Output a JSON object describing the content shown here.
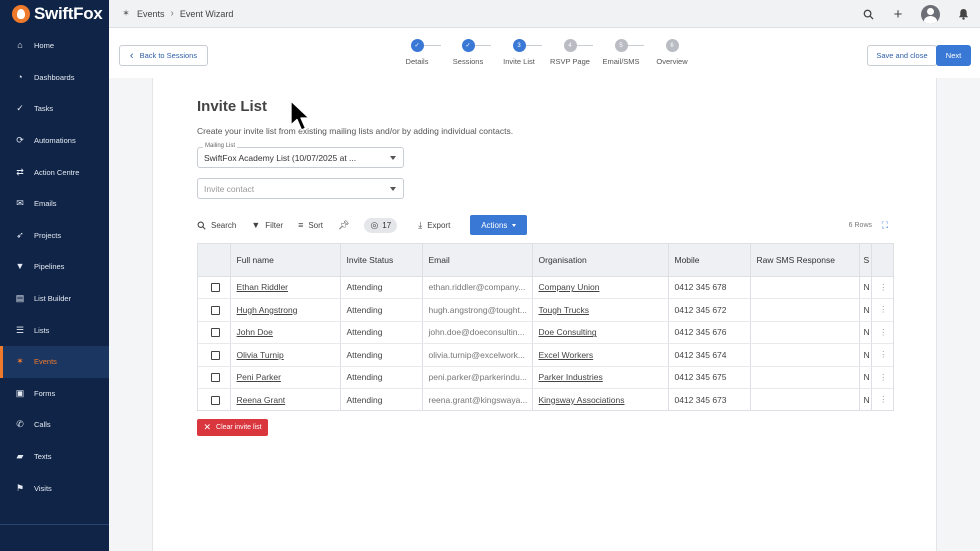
{
  "app": {
    "name": "SwiftFox",
    "brand_color": "#f07a2c",
    "sidebar_bg": "#0f2447",
    "accent": "#3a78d6",
    "danger": "#d9363e"
  },
  "sidebar": {
    "items": [
      {
        "label": "Home",
        "icon": "home-icon"
      },
      {
        "label": "Dashboards",
        "icon": "dashboard-icon"
      },
      {
        "label": "Tasks",
        "icon": "check-circle-icon"
      },
      {
        "label": "Automations",
        "icon": "sync-icon"
      },
      {
        "label": "Action Centre",
        "icon": "shuffle-icon"
      },
      {
        "label": "Emails",
        "icon": "mail-icon"
      },
      {
        "label": "Projects",
        "icon": "rocket-icon"
      },
      {
        "label": "Pipelines",
        "icon": "filter-icon"
      },
      {
        "label": "List Builder",
        "icon": "list-builder-icon"
      },
      {
        "label": "Lists",
        "icon": "list-icon"
      },
      {
        "label": "Events",
        "icon": "party-popper-icon"
      },
      {
        "label": "Forms",
        "icon": "clipboard-icon"
      },
      {
        "label": "Calls",
        "icon": "phone-icon"
      },
      {
        "label": "Texts",
        "icon": "chat-icon"
      },
      {
        "label": "Visits",
        "icon": "map-icon"
      }
    ],
    "active": "Events"
  },
  "breadcrumb": {
    "section": "Events",
    "page": "Event Wizard"
  },
  "wizard": {
    "back_label": "Back to Sessions",
    "save_label": "Save and close",
    "next_label": "Next",
    "steps": [
      {
        "num": "1",
        "label": "Details",
        "state": "done"
      },
      {
        "num": "2",
        "label": "Sessions",
        "state": "done"
      },
      {
        "num": "3",
        "label": "Invite List",
        "state": "current"
      },
      {
        "num": "4",
        "label": "RSVP Page",
        "state": "todo"
      },
      {
        "num": "5",
        "label": "Email/SMS",
        "state": "todo"
      },
      {
        "num": "6",
        "label": "Overview",
        "state": "todo"
      }
    ]
  },
  "main": {
    "title": "Invite List",
    "subtitle": "Create your invite list from existing mailing lists and/or by adding individual contacts.",
    "mailing_list": {
      "label": "Mailing List",
      "value": "SwiftFox Academy List (10/07/2025 at ..."
    },
    "invite_contact": {
      "placeholder": "Invite contact"
    },
    "toolbar": {
      "search": "Search",
      "filter": "Filter",
      "sort": "Sort",
      "hidden_count": "17",
      "export": "Export",
      "actions": "Actions",
      "rows": "6 Rows"
    },
    "table": {
      "columns": [
        "Full name",
        "Invite Status",
        "Email",
        "Organisation",
        "Mobile",
        "Raw SMS Response",
        "S"
      ],
      "rows": [
        {
          "name": "Ethan Riddler",
          "status": "Attending",
          "email": "ethan.riddler@company...",
          "org": "Company Union",
          "mobile": "0412 345 678",
          "raw": "",
          "s": "N"
        },
        {
          "name": "Hugh Angstrong",
          "status": "Attending",
          "email": "hugh.angstrong@tought...",
          "org": "Tough Trucks",
          "mobile": "0412 345 672",
          "raw": "",
          "s": "N"
        },
        {
          "name": "John Doe",
          "status": "Attending",
          "email": "john.doe@doeconsultin...",
          "org": "Doe Consulting",
          "mobile": "0412 345 676",
          "raw": "",
          "s": "N"
        },
        {
          "name": "Olivia Turnip",
          "status": "Attending",
          "email": "olivia.turnip@excelwork...",
          "org": "Excel Workers",
          "mobile": "0412 345 674",
          "raw": "",
          "s": "N"
        },
        {
          "name": "Peni Parker",
          "status": "Attending",
          "email": "peni.parker@parkerindu...",
          "org": "Parker Industries",
          "mobile": "0412 345 675",
          "raw": "",
          "s": "N"
        },
        {
          "name": "Reena Grant",
          "status": "Attending",
          "email": "reena.grant@kingswaya...",
          "org": "Kingsway Associations",
          "mobile": "0412 345 673",
          "raw": "",
          "s": "N"
        }
      ]
    },
    "clear_label": "Clear invite list"
  }
}
